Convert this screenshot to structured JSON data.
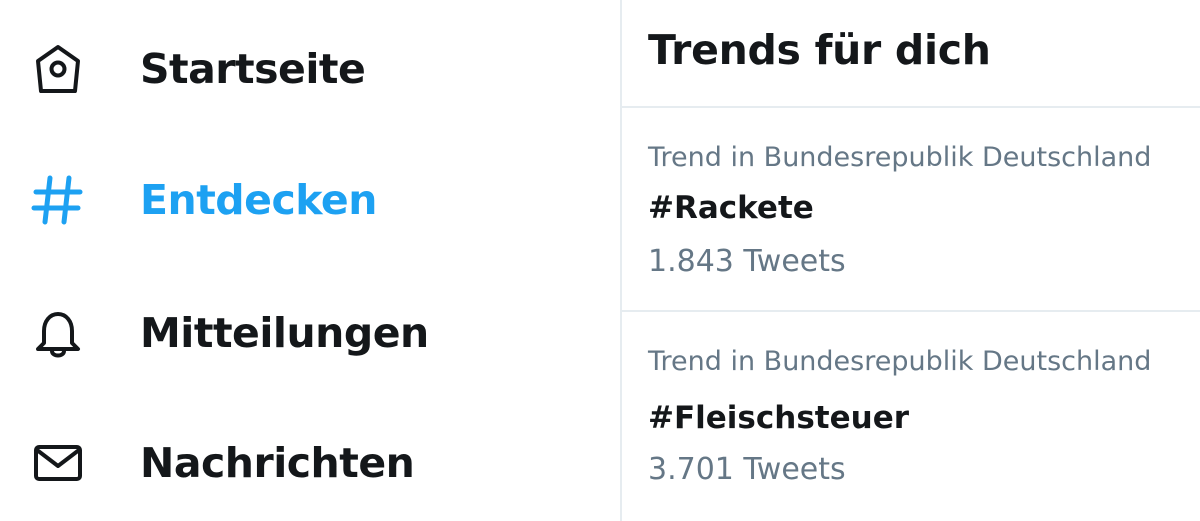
{
  "colors": {
    "accent": "#1da1f2",
    "text_primary": "#14171a",
    "text_secondary": "#657786",
    "divider": "#e6ecf0"
  },
  "sidebar": {
    "items": [
      {
        "label": "Startseite",
        "icon": "home-icon",
        "active": false
      },
      {
        "label": "Entdecken",
        "icon": "hashtag-icon",
        "active": true
      },
      {
        "label": "Mitteilungen",
        "icon": "bell-icon",
        "active": false
      },
      {
        "label": "Nachrichten",
        "icon": "envelope-icon",
        "active": false
      }
    ]
  },
  "trends": {
    "title": "Trends für dich",
    "items": [
      {
        "context": "Trend in Bundesrepublik Deutschland",
        "name": "#Rackete",
        "count": "1.843 Tweets"
      },
      {
        "context": "Trend in Bundesrepublik Deutschland",
        "name": "#Fleischsteuer",
        "count": "3.701 Tweets"
      }
    ]
  }
}
